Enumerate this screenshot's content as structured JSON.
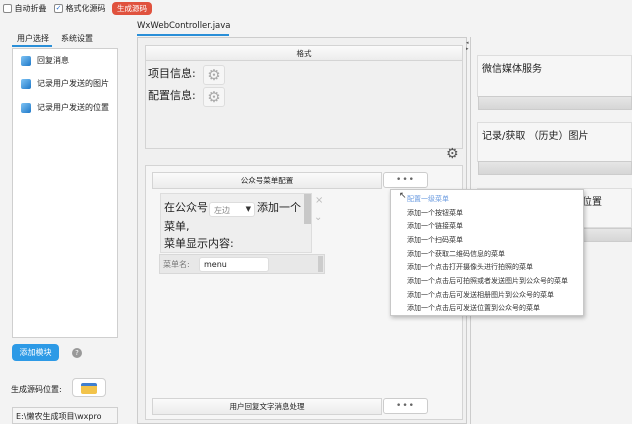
{
  "toolbar": {
    "auto_fold": "自动折叠",
    "auto_fold_checked": false,
    "format_source": "格式化源码",
    "format_source_checked": true,
    "generate": "生成源码"
  },
  "left": {
    "tabs": [
      "用户选择",
      "系统设置"
    ],
    "items": [
      "回复消息",
      "记录用户发送的图片",
      "记录用户发送的位置"
    ],
    "add_button": "添加模块",
    "help": "?",
    "output_label": "生成源码位置:",
    "output_path": "E:\\懒农生成项目\\wxpro"
  },
  "editor": {
    "tab": "WxWebController.java",
    "format_header": "格式",
    "project_info": "项目信息:",
    "config_info": "配置信息:",
    "menu_panel": {
      "title": "公众号菜单配置",
      "dots": "•••",
      "text1": "在公众号",
      "position_select": "左边",
      "text2": "添加一个",
      "text3": "菜单,",
      "text4": "菜单显示内容:",
      "menu_name_label": "菜单名:",
      "menu_name_value": "menu",
      "close": "×"
    },
    "reply_panel": {
      "title": "用户回复文字消息处理",
      "dots": "•••"
    }
  },
  "dropdown": {
    "items": [
      "配置一级菜单",
      "添加一个按钮菜单",
      "添加一个链接菜单",
      "添加一个扫码菜单",
      "添加一个获取二维码信息的菜单",
      "添加一个点击打开摄像头进行拍照的菜单",
      "添加一个点击后可拍照或者发送图片到公众号的菜单",
      "添加一个点击后可发送相册图片到公众号的菜单",
      "添加一个点击后可发送位置到公众号的菜单"
    ]
  },
  "right": {
    "cards": [
      "微信媒体服务",
      "记录/获取 （历史）图片",
      "位置"
    ]
  }
}
